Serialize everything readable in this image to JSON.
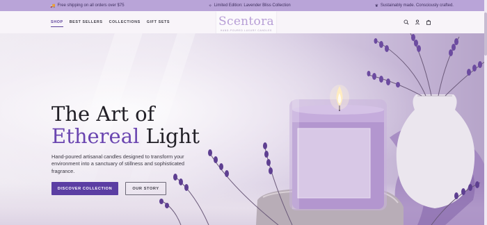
{
  "announcement": {
    "items": [
      {
        "icon": "truck-icon",
        "text": "Free shipping on all orders over $75"
      },
      {
        "icon": "sparkle-icon",
        "text": "Limited Edition: Lavender Bliss Collection"
      },
      {
        "icon": "leaf-icon",
        "text": "Sustainably made. Consciously crafted."
      }
    ]
  },
  "nav": {
    "links": [
      "SHOP",
      "BEST SELLERS",
      "COLLECTIONS",
      "GIFT SETS"
    ],
    "active": "SHOP",
    "icons": [
      "search-icon",
      "user-icon",
      "bag-icon"
    ]
  },
  "brand": {
    "logo": "Scentora",
    "tagline": "HAND-POURED LUXURY CANDLES",
    "color": "#b79ed6"
  },
  "hero": {
    "title_line1": "The Art of",
    "title_accent": "Ethereal",
    "title_rest": " Light",
    "subtitle": "Hand-poured artisanal candles designed to transform your environment into a sanctuary of stillness and sophisticated fragrance.",
    "primary_cta": "DISCOVER COLLECTION",
    "secondary_cta": "OUR STORY",
    "accent_color": "#6a45b0",
    "button_color": "#5b3ea3"
  }
}
